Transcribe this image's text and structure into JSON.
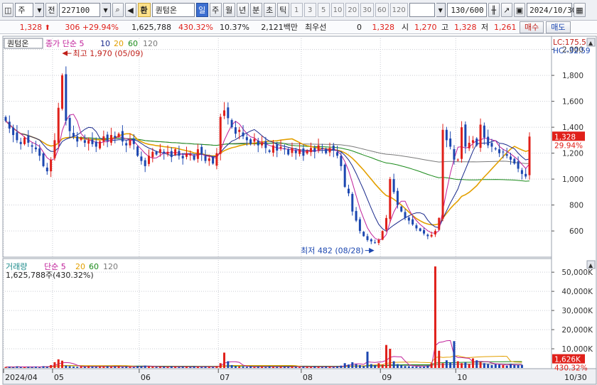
{
  "toolbar": {
    "market_label": "주",
    "prev_label": "전",
    "code": "227100",
    "name_tag": "환",
    "name": "퀀텀온",
    "periods": [
      "일",
      "주",
      "월",
      "년",
      "분",
      "초",
      "틱"
    ],
    "active_period": "일",
    "numbers": [
      "1",
      "3",
      "5",
      "10",
      "20",
      "30",
      "60",
      "120"
    ],
    "count": "130",
    "count_total": "/600",
    "date": "2024/10/30"
  },
  "quote": {
    "price": "1,328",
    "change": "306",
    "change_pct": "+29.94%",
    "volume": "1,625,788",
    "volume_ratio": "430.32%",
    "turnover": "10.37%",
    "amount": "2,121백만",
    "preferred_label": "최우선",
    "preferred_value": "0",
    "last_value": "1,328",
    "open_label": "시",
    "open": "1,270",
    "high_label": "고",
    "high": "1,328",
    "low_label": "저",
    "low": "1,261",
    "buy_label": "매수",
    "sell_label": "매도"
  },
  "colors": {
    "up": "#e0201a",
    "down": "#1c47b0",
    "ma5": "#c0209a",
    "ma10": "#1a2a8c",
    "ma20": "#e3a000",
    "ma60": "#1a8a1a",
    "ma120": "#7a7a7a",
    "accent": "#3d6fd1"
  },
  "chart_data": [
    {
      "type": "line",
      "title": "퀀텀온",
      "legend": [
        "종가 단순 5",
        "10",
        "20",
        "60",
        "120"
      ],
      "legend_stock": "퀀텀온",
      "legend_prefix": "종가 단순",
      "ma_periods": [
        "5",
        "10",
        "20",
        "60",
        "120"
      ],
      "lc_label": "LC:175.52",
      "hc_label": "HC:-32.59",
      "current_price_label": "1,328",
      "current_pct_label": "29.94%",
      "annotation_high": "최고 1,970 (05/09)",
      "annotation_low": "최저 482 (08/28)",
      "y_ticks": [
        "2,000",
        "1,800",
        "1,600",
        "1,400",
        "1,200",
        "1,000",
        "800",
        "600"
      ],
      "y_tick_values": [
        2000,
        1800,
        1600,
        1400,
        1200,
        1000,
        800,
        600
      ],
      "ylim": [
        420,
        2080
      ],
      "x_labels": [
        "2024/04",
        "05",
        "06",
        "07",
        "08",
        "09",
        "10"
      ],
      "x_label_index": [
        0,
        13,
        36,
        57,
        79,
        100,
        120
      ],
      "right_date": "10/30",
      "n_days": 140,
      "closes": [
        1450,
        1390,
        1340,
        1300,
        1270,
        1320,
        1280,
        1250,
        1230,
        1180,
        1100,
        1060,
        1150,
        1300,
        1550,
        1800,
        1450,
        1370,
        1330,
        1290,
        1320,
        1280,
        1300,
        1270,
        1250,
        1290,
        1330,
        1300,
        1340,
        1320,
        1350,
        1290,
        1260,
        1300,
        1270,
        1180,
        1140,
        1100,
        1180,
        1210,
        1190,
        1230,
        1200,
        1210,
        1170,
        1230,
        1180,
        1160,
        1200,
        1190,
        1150,
        1230,
        1190,
        1140,
        1160,
        1120,
        1200,
        1480,
        1530,
        1470,
        1400,
        1350,
        1380,
        1330,
        1300,
        1270,
        1310,
        1260,
        1280,
        1240,
        1210,
        1260,
        1220,
        1250,
        1230,
        1190,
        1240,
        1200,
        1230,
        1180,
        1220,
        1240,
        1210,
        1260,
        1240,
        1200,
        1240,
        1220,
        1180,
        1100,
        940,
        890,
        750,
        680,
        600,
        560,
        530,
        520,
        510,
        530,
        600,
        700,
        1000,
        900,
        800,
        750,
        700,
        680,
        650,
        620,
        600,
        580,
        560,
        570,
        600,
        700,
        1380,
        1300,
        1250,
        1150,
        1150,
        1400,
        1250,
        1280,
        1300,
        1260,
        1420,
        1320,
        1260,
        1250,
        1230,
        1200,
        1210,
        1180,
        1150,
        1120,
        1080,
        1040,
        1020,
        1328
      ],
      "volume_legend_label": "거래량",
      "volume_legend_prefix": "단순",
      "volume_ma_periods": [
        "5",
        "20",
        "60",
        "120"
      ],
      "volume_info": "1,625,788주(430.32%)",
      "volume_y_ticks": [
        "50,000K",
        "40,000K",
        "30,000K",
        "20,000K",
        "10,000K"
      ],
      "volume_y_tick_values": [
        50000,
        40000,
        30000,
        20000,
        10000
      ],
      "volume_current_label": "1,626K",
      "volume_pct_label": "430.32%",
      "volume_ylim": [
        0,
        56000
      ],
      "volumes_k": [
        500,
        600,
        400,
        800,
        500,
        400,
        600,
        500,
        700,
        400,
        900,
        600,
        1500,
        3000,
        4500,
        3800,
        1200,
        900,
        700,
        600,
        800,
        600,
        900,
        700,
        600,
        800,
        700,
        900,
        600,
        700,
        800,
        500,
        700,
        600,
        500,
        900,
        800,
        1200,
        700,
        600,
        500,
        600,
        700,
        500,
        800,
        600,
        500,
        700,
        600,
        500,
        800,
        600,
        500,
        700,
        600,
        500,
        900,
        2500,
        8000,
        3500,
        1500,
        900,
        800,
        700,
        600,
        800,
        500,
        600,
        700,
        500,
        800,
        600,
        500,
        700,
        600,
        500,
        800,
        600,
        500,
        700,
        600,
        500,
        800,
        600,
        500,
        700,
        600,
        500,
        800,
        1200,
        2500,
        1800,
        3000,
        2000,
        1500,
        1000,
        8500,
        2000,
        1500,
        2500,
        1800,
        12000,
        10000,
        3500,
        2000,
        1500,
        1000,
        900,
        800,
        700,
        600,
        800,
        1200,
        2500,
        53000,
        9000,
        2500,
        4000,
        3000,
        14000,
        3500,
        2500,
        3000,
        2000,
        5000,
        4000,
        3000,
        2500,
        2000,
        1500,
        2000,
        1800,
        1500,
        1200,
        2000,
        1600,
        1500,
        1626
      ]
    }
  ]
}
